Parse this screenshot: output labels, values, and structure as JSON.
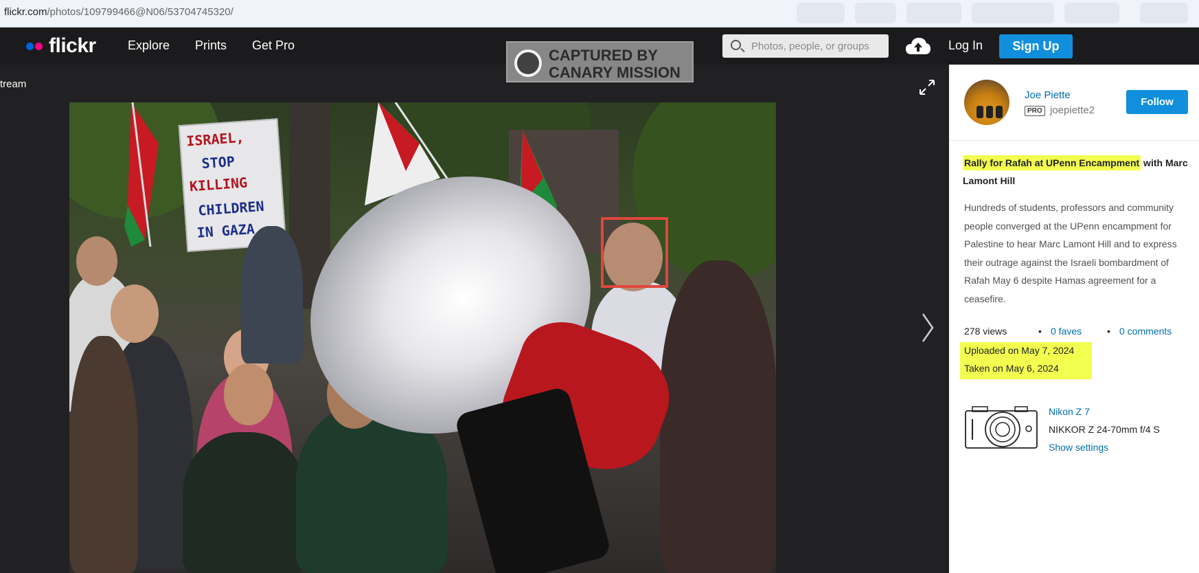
{
  "browser": {
    "url_host": "flickr.com",
    "url_path": "/photos/109799466@N06/53704745320/"
  },
  "nav": {
    "logo": "flickr",
    "links": [
      "Explore",
      "Prints",
      "Get Pro"
    ],
    "search_placeholder": "Photos, people, or groups",
    "login": "Log In",
    "signup": "Sign Up"
  },
  "watermark": {
    "line1": "CAPTURED BY",
    "line2": "CANARY MISSION"
  },
  "stage": {
    "back_label": "tream"
  },
  "photo": {
    "sign_lines": [
      "ISRAEL,",
      "STOP",
      "KILLING",
      "CHILDREN",
      "IN GAZA"
    ]
  },
  "sidebar": {
    "author": "Joe Piette",
    "pro_badge": "PRO",
    "handle": "joepiette2",
    "follow": "Follow",
    "title_highlighted": "Rally for Rafah at UPenn Encampment",
    "title_rest": " with Marc Lamont Hill",
    "description": "Hundreds of students, professors and community people converged at the UPenn encampment for Palestine to hear Marc Lamont Hill and to express their outrage against the Israeli bombardment of Rafah May 6 despite Hamas agreement for a ceasefire.",
    "views": "278 views",
    "faves": "0 faves",
    "comments": "0 comments",
    "uploaded": "Uploaded on May 7, 2024",
    "taken": "Taken on May 6, 2024",
    "camera": "Nikon Z 7",
    "lens": "NIKKOR Z 24-70mm f/4 S",
    "show_settings": "Show settings"
  },
  "colors": {
    "link": "#006dac",
    "button": "#128fdc",
    "highlight": "#f2ff4f",
    "nav_bg": "#1b1b1d",
    "annotation_box": "#e0463d"
  }
}
